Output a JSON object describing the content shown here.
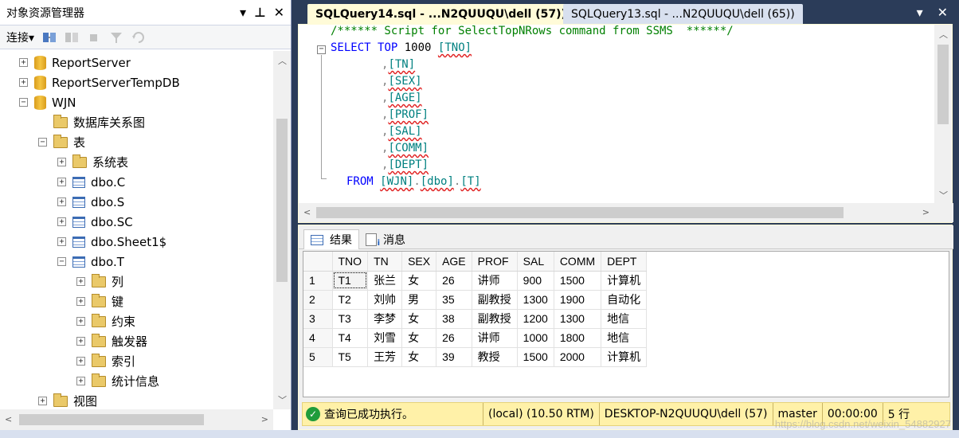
{
  "object_explorer": {
    "title": "对象资源管理器",
    "pin_label": "▾",
    "pin2_label": "⊥",
    "close_label": "✕",
    "connect_label": "连接",
    "connect_arrow": "▾",
    "tree": [
      {
        "label": "ReportServer",
        "expand": "+",
        "icon": "database-icon",
        "indent": 0
      },
      {
        "label": "ReportServerTempDB",
        "expand": "+",
        "icon": "database-icon",
        "indent": 0
      },
      {
        "label": "WJN",
        "expand": "−",
        "icon": "database-icon",
        "indent": 0
      },
      {
        "label": "数据库关系图",
        "expand": "",
        "icon": "folder-icon",
        "indent": 1
      },
      {
        "label": "表",
        "expand": "−",
        "icon": "folder-icon",
        "indent": 1
      },
      {
        "label": "系统表",
        "expand": "+",
        "icon": "folder-icon",
        "indent": 2
      },
      {
        "label": "dbo.C",
        "expand": "+",
        "icon": "table-icon",
        "indent": 2
      },
      {
        "label": "dbo.S",
        "expand": "+",
        "icon": "table-icon",
        "indent": 2
      },
      {
        "label": "dbo.SC",
        "expand": "+",
        "icon": "table-icon",
        "indent": 2
      },
      {
        "label": "dbo.Sheet1$",
        "expand": "+",
        "icon": "table-icon",
        "indent": 2
      },
      {
        "label": "dbo.T",
        "expand": "−",
        "icon": "table-icon",
        "indent": 2
      },
      {
        "label": "列",
        "expand": "+",
        "icon": "folder-icon",
        "indent": 3
      },
      {
        "label": "键",
        "expand": "+",
        "icon": "folder-icon",
        "indent": 3
      },
      {
        "label": "约束",
        "expand": "+",
        "icon": "folder-icon",
        "indent": 3
      },
      {
        "label": "触发器",
        "expand": "+",
        "icon": "folder-icon",
        "indent": 3
      },
      {
        "label": "索引",
        "expand": "+",
        "icon": "folder-icon",
        "indent": 3
      },
      {
        "label": "统计信息",
        "expand": "+",
        "icon": "folder-icon",
        "indent": 3
      },
      {
        "label": "视图",
        "expand": "+",
        "icon": "folder-icon",
        "indent": 1
      }
    ]
  },
  "tabs": {
    "active": "SQLQuery14.sql - ...N2QUUQU\\dell (57))",
    "inactive": "SQLQuery13.sql - ...N2QUUQU\\dell (65))",
    "dropdown_label": "▾",
    "close_label": "✕"
  },
  "editor": {
    "comment": "/****** Script for SelectTopNRows command from SSMS  ******/",
    "select_kw": "SELECT",
    "top_kw": "TOP",
    "top_n": "1000",
    "first_col": "[TNO]",
    "columns": [
      "[TN]",
      "[SEX]",
      "[AGE]",
      "[PROF]",
      "[SAL]",
      "[COMM]",
      "[DEPT]"
    ],
    "comma": ",",
    "from_kw": "FROM",
    "from_db": "[WJN]",
    "from_schema": "[dbo]",
    "from_table": "[T]",
    "dot": "."
  },
  "results": {
    "tab_results": "结果",
    "tab_messages": "消息",
    "columns": [
      "TNO",
      "TN",
      "SEX",
      "AGE",
      "PROF",
      "SAL",
      "COMM",
      "DEPT"
    ],
    "rows": [
      [
        "1",
        "T1",
        "张兰",
        "女",
        "26",
        "讲师",
        "900",
        "1500",
        "计算机"
      ],
      [
        "2",
        "T2",
        "刘帅",
        "男",
        "35",
        "副教授",
        "1300",
        "1900",
        "自动化"
      ],
      [
        "3",
        "T3",
        "李梦",
        "女",
        "38",
        "副教授",
        "1200",
        "1300",
        "地信"
      ],
      [
        "4",
        "T4",
        "刘雪",
        "女",
        "26",
        "讲师",
        "1000",
        "1800",
        "地信"
      ],
      [
        "5",
        "T5",
        "王芳",
        "女",
        "39",
        "教授",
        "1500",
        "2000",
        "计算机"
      ]
    ]
  },
  "status": {
    "message": "查询已成功执行。",
    "server": "(local) (10.50 RTM)",
    "user": "DESKTOP-N2QUUQU\\dell (57)",
    "database": "master",
    "elapsed": "00:00:00",
    "row_count": "5 行"
  },
  "watermark": "https://blog.csdn.net/weixin_54882927",
  "colors": {
    "frame": "#2b3c59",
    "active_tab": "#fffbd8",
    "status_bar": "#fff1a8",
    "keyword": "#0000ff",
    "comment": "#008000",
    "identifier": "#008080"
  }
}
